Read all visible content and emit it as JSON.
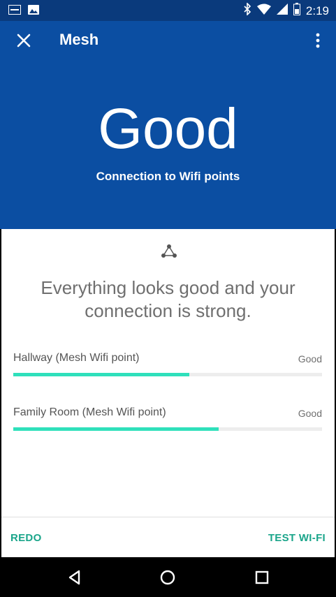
{
  "status_bar": {
    "time": "2:19",
    "left_icons": [
      "sonos-notification-icon",
      "image-notification-icon"
    ],
    "right_icons": [
      "bluetooth-icon",
      "wifi-icon",
      "cell-signal-icon",
      "battery-icon"
    ]
  },
  "toolbar": {
    "title": "Mesh",
    "close_icon": "close-icon",
    "more_icon": "more-vert-icon"
  },
  "hero": {
    "status": "Good",
    "subtitle": "Connection to Wifi points"
  },
  "card": {
    "icon": "mesh-network-icon",
    "headline": "Everything looks good and your connection is strong.",
    "points": [
      {
        "name": "Hallway (Mesh Wifi point)",
        "quality": "Good",
        "signal_fraction": 0.57
      },
      {
        "name": "Family Room (Mesh Wifi point)",
        "quality": "Good",
        "signal_fraction": 0.665
      }
    ],
    "actions": {
      "redo": "REDO",
      "test_wifi": "TEST WI-FI"
    }
  },
  "colors": {
    "status_bar": "#0a3a7c",
    "header": "#0b4ea2",
    "accent": "#1aa58a",
    "bar_fill": "#2fe0bb"
  },
  "nav_bar": {
    "icons": [
      "back-icon",
      "home-icon",
      "recents-icon"
    ]
  }
}
